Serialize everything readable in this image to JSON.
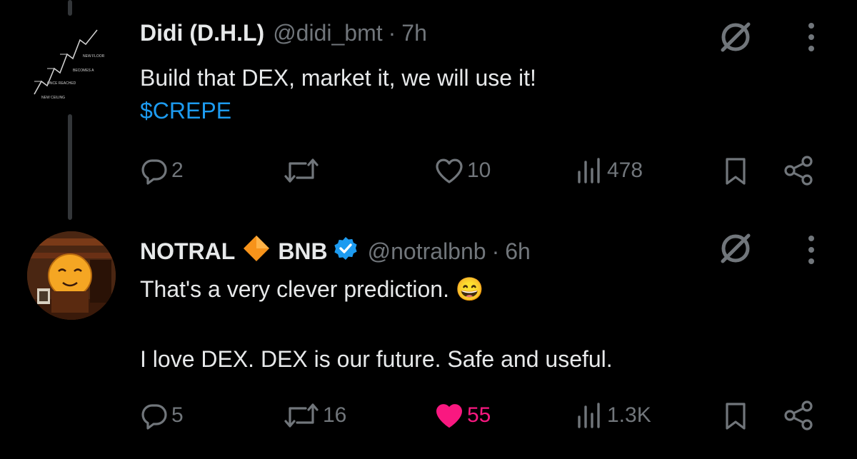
{
  "tweets": [
    {
      "name": "Didi (D.H.L)",
      "handle": "@didi_bmt",
      "separator": "·",
      "time": "7h",
      "text": "Build that DEX, market it, we will use it!",
      "cashtag": "$CREPE",
      "avatar_chart_labels": [
        "NEW FLOOR",
        "BECOMES A",
        "ONCE REACHED",
        "NEW CEILING"
      ],
      "actions": {
        "replies": "2",
        "reposts": "",
        "likes": "10",
        "views": "478"
      },
      "liked": false
    },
    {
      "name_part1": "NOTRAL",
      "name_part2": "BNB",
      "handle": "@notralbnb",
      "separator": "·",
      "time": "6h",
      "text_line1": "That's a very clever prediction. 😄",
      "text_line2": "I love DEX. DEX is our future. Safe and useful.",
      "actions": {
        "replies": "5",
        "reposts": "16",
        "likes": "55",
        "views": "1.3K"
      },
      "liked": true
    }
  ],
  "colors": {
    "like_active": "#f91880",
    "link": "#1d9bf0",
    "verified": "#1d9bf0",
    "muted": "#71767b",
    "diamond": "#f7931a"
  }
}
